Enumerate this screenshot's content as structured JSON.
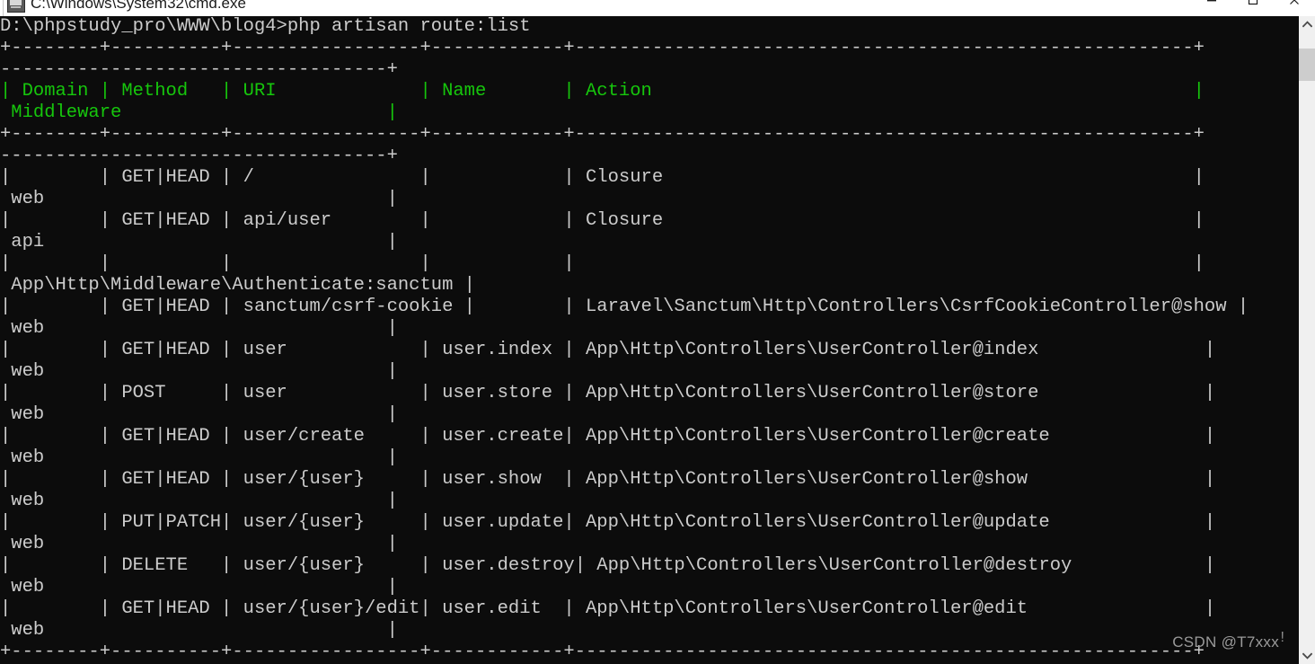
{
  "window": {
    "title": "C:\\Windows\\System32\\cmd.exe",
    "icon": "cmd-icon",
    "minimize_label": "Minimize",
    "maximize_label": "Maximize",
    "close_label": "Close"
  },
  "terminal": {
    "prompt_line": "D:\\phpstudy_pro\\WWW\\blog4>php artisan route:list",
    "background_color": "#0c0c0c",
    "foreground_color": "#cccccc",
    "header_color": "#16c60c",
    "columns": [
      "Domain",
      "Method",
      "URI",
      "Name",
      "Action",
      "Middleware"
    ],
    "lines": [
      {
        "text": "+--------+----------+-----------------+------------+--------------------------------------------------------+",
        "style": "sep"
      },
      {
        "text": "-----------------------------------+",
        "style": "sep"
      },
      {
        "text": "| Domain | Method   | URI             | Name       | Action                                                 |",
        "style": "green"
      },
      {
        "text": " Middleware                        |",
        "style": "green"
      },
      {
        "text": "+--------+----------+-----------------+------------+--------------------------------------------------------+",
        "style": "sep"
      },
      {
        "text": "-----------------------------------+",
        "style": "sep"
      },
      {
        "text": "|        | GET|HEAD | /               |            | Closure                                                |",
        "style": "out"
      },
      {
        "text": " web                               |",
        "style": "out"
      },
      {
        "text": "|        | GET|HEAD | api/user        |            | Closure                                                |",
        "style": "out"
      },
      {
        "text": " api                               |",
        "style": "out"
      },
      {
        "text": "|        |          |                 |            |                                                        |",
        "style": "out"
      },
      {
        "text": " App\\Http\\Middleware\\Authenticate:sanctum |",
        "style": "out"
      },
      {
        "text": "|        | GET|HEAD | sanctum/csrf-cookie |        | Laravel\\Sanctum\\Http\\Controllers\\CsrfCookieController@show |",
        "style": "out"
      },
      {
        "text": " web                               |",
        "style": "out"
      },
      {
        "text": "|        | GET|HEAD | user            | user.index | App\\Http\\Controllers\\UserController@index               |",
        "style": "out"
      },
      {
        "text": " web                               |",
        "style": "out"
      },
      {
        "text": "|        | POST     | user            | user.store | App\\Http\\Controllers\\UserController@store               |",
        "style": "out"
      },
      {
        "text": " web                               |",
        "style": "out"
      },
      {
        "text": "|        | GET|HEAD | user/create     | user.create| App\\Http\\Controllers\\UserController@create              |",
        "style": "out"
      },
      {
        "text": " web                               |",
        "style": "out"
      },
      {
        "text": "|        | GET|HEAD | user/{user}     | user.show  | App\\Http\\Controllers\\UserController@show                |",
        "style": "out"
      },
      {
        "text": " web                               |",
        "style": "out"
      },
      {
        "text": "|        | PUT|PATCH| user/{user}     | user.update| App\\Http\\Controllers\\UserController@update              |",
        "style": "out"
      },
      {
        "text": " web                               |",
        "style": "out"
      },
      {
        "text": "|        | DELETE   | user/{user}     | user.destroy| App\\Http\\Controllers\\UserController@destroy            |",
        "style": "out"
      },
      {
        "text": " web                               |",
        "style": "out"
      },
      {
        "text": "|        | GET|HEAD | user/{user}/edit| user.edit  | App\\Http\\Controllers\\UserController@edit                |",
        "style": "out"
      },
      {
        "text": " web                               |",
        "style": "out"
      },
      {
        "text": "+--------+----------+-----------------+------------+--------------------------------------------------------+",
        "style": "sep"
      }
    ],
    "routes": [
      {
        "domain": "",
        "method": "GET|HEAD",
        "uri": "/",
        "name": "",
        "action": "Closure",
        "middleware": "web"
      },
      {
        "domain": "",
        "method": "GET|HEAD",
        "uri": "api/user",
        "name": "",
        "action": "Closure",
        "middleware": "api"
      },
      {
        "domain": "",
        "method": "",
        "uri": "",
        "name": "",
        "action": "",
        "middleware": "App\\Http\\Middleware\\Authenticate:sanctum"
      },
      {
        "domain": "",
        "method": "GET|HEAD",
        "uri": "sanctum/csrf-cookie",
        "name": "",
        "action": "Laravel\\Sanctum\\Http\\Controllers\\CsrfCookieController@show",
        "middleware": "web"
      },
      {
        "domain": "",
        "method": "GET|HEAD",
        "uri": "user",
        "name": "user.index",
        "action": "App\\Http\\Controllers\\UserController@index",
        "middleware": "web"
      },
      {
        "domain": "",
        "method": "POST",
        "uri": "user",
        "name": "user.store",
        "action": "App\\Http\\Controllers\\UserController@store",
        "middleware": "web"
      },
      {
        "domain": "",
        "method": "GET|HEAD",
        "uri": "user/create",
        "name": "user.create",
        "action": "App\\Http\\Controllers\\UserController@create",
        "middleware": "web"
      },
      {
        "domain": "",
        "method": "GET|HEAD",
        "uri": "user/{user}",
        "name": "user.show",
        "action": "App\\Http\\Controllers\\UserController@show",
        "middleware": "web"
      },
      {
        "domain": "",
        "method": "PUT|PATCH",
        "uri": "user/{user}",
        "name": "user.update",
        "action": "App\\Http\\Controllers\\UserController@update",
        "middleware": "web"
      },
      {
        "domain": "",
        "method": "DELETE",
        "uri": "user/{user}",
        "name": "user.destroy",
        "action": "App\\Http\\Controllers\\UserController@destroy",
        "middleware": "web"
      },
      {
        "domain": "",
        "method": "GET|HEAD",
        "uri": "user/{user}/edit",
        "name": "user.edit",
        "action": "App\\Http\\Controllers\\UserController@edit",
        "middleware": "web"
      }
    ]
  },
  "scrollbar": {
    "up_label": "Scroll up",
    "down_label": "Scroll down",
    "thumb_label": "Scroll thumb"
  },
  "watermark": {
    "text": "CSDN @T7xxx"
  }
}
